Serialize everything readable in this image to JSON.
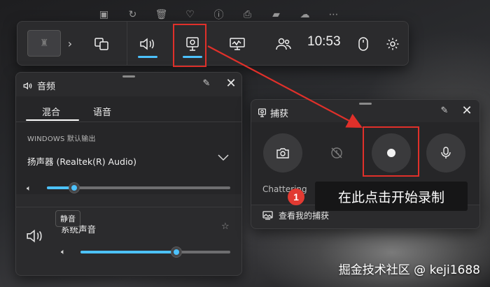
{
  "gamebar": {
    "time": "10:53",
    "widgets": [
      "thumbnail-icon",
      "widget-gallery-icon",
      "audio-icon",
      "capture-icon",
      "performance-icon",
      "xbox-social-icon",
      "mouse-icon",
      "settings-icon"
    ],
    "accent": "#4cc2ff"
  },
  "audio_panel": {
    "title": "音频",
    "tabs": [
      "混合",
      "语音"
    ],
    "section_label": "WINDOWS 默认输出",
    "device": "扬声器 (Realtek(R) Audio)",
    "master_volume": 0.15,
    "tooltip": "静音",
    "app_name": "系统声音",
    "app_volume": 0.64
  },
  "capture_panel": {
    "title": "捕获",
    "app_label": "Chattering",
    "link_label": "查看我的捕获"
  },
  "annotation": {
    "badge": "1",
    "text": "在此点击开始录制",
    "color": "#e0302a"
  },
  "watermark": "掘金技术社区 @ keji1688"
}
